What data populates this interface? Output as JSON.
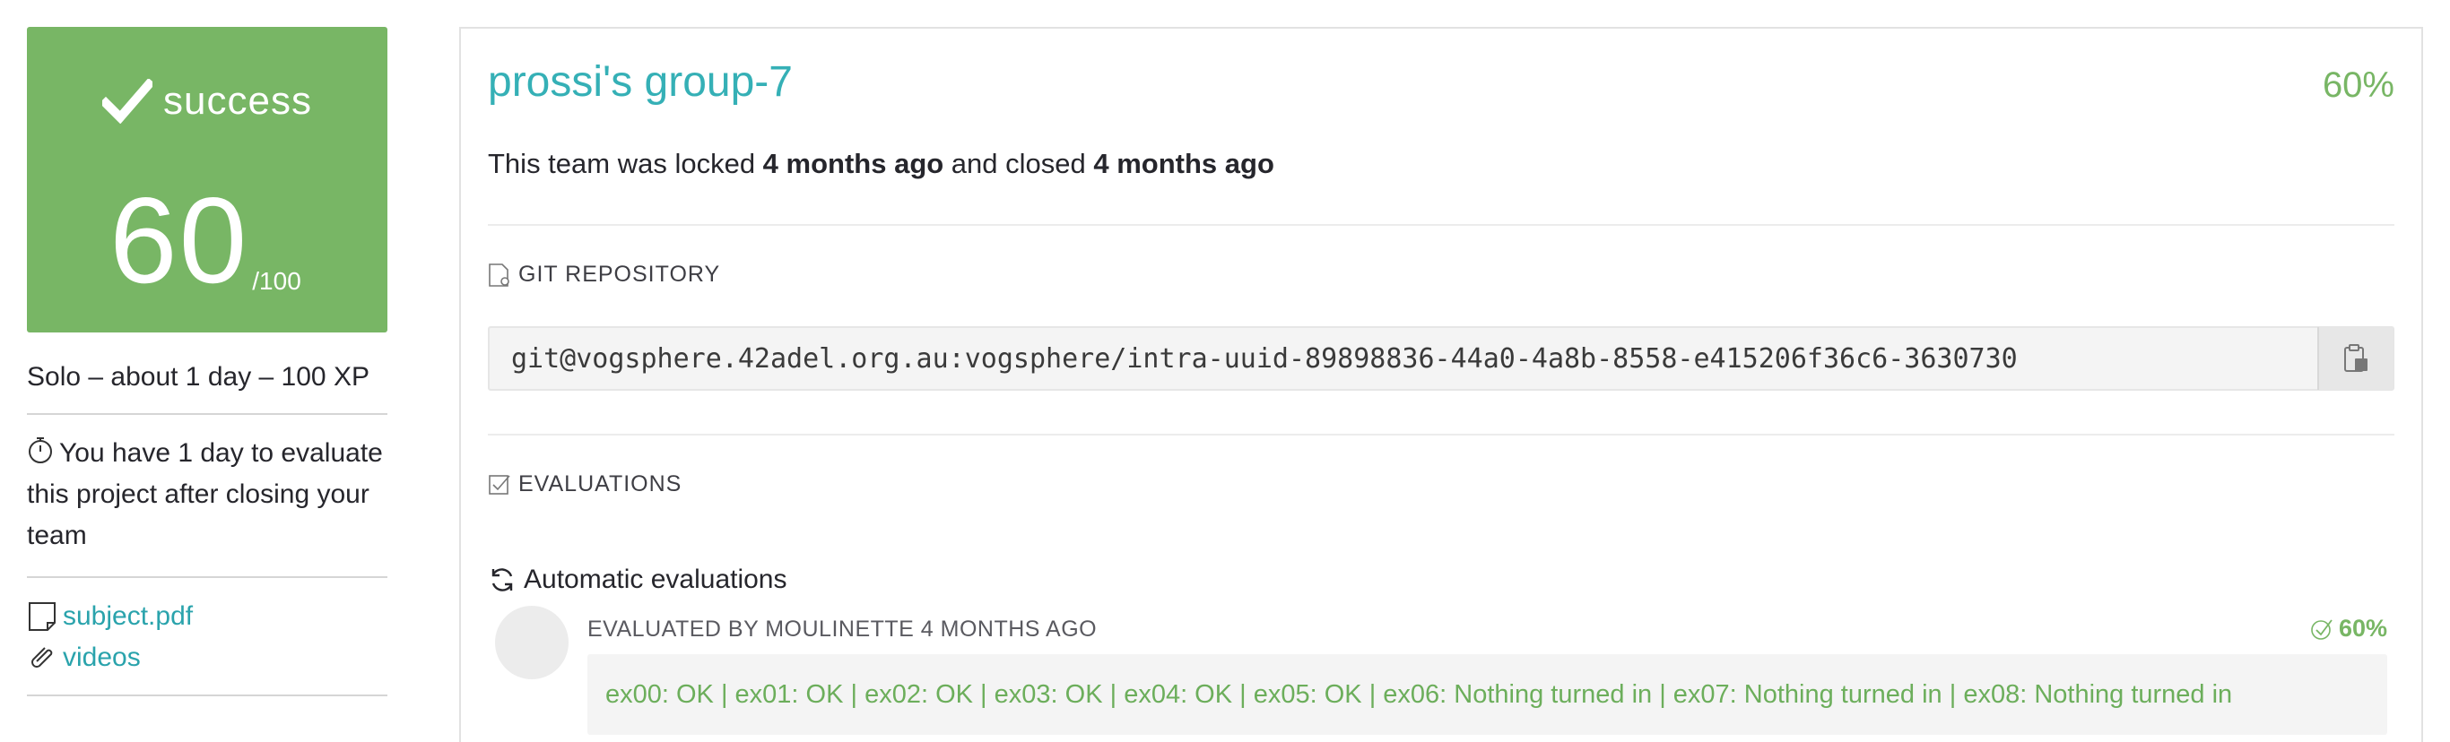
{
  "score_card": {
    "status": "success",
    "score": "60",
    "max": "/100"
  },
  "project_meta": "Solo – about 1 day – 100 XP",
  "evaluation_note": "You have 1 day to evaluate this project after closing your team",
  "links": {
    "subject": "subject.pdf",
    "videos": "videos"
  },
  "team": {
    "title": "prossi's group-7",
    "percent": "60%",
    "lock_prefix": "This team was locked ",
    "locked_ago": "4 months ago",
    "lock_middle": " and closed ",
    "closed_ago": "4 months ago"
  },
  "git": {
    "section_label": "GIT REPOSITORY",
    "url": "git@vogsphere.42adel.org.au:vogsphere/intra-uuid-89898836-44a0-4a8b-8558-e415206f36c6-3630730"
  },
  "evaluations": {
    "section_label": "EVALUATIONS",
    "automatic_label": "Automatic evaluations",
    "evaluated_by": "EVALUATED BY MOULINETTE 4 MONTHS AGO",
    "percent": "60%",
    "result": "ex00: OK | ex01: OK | ex02: OK | ex03: OK | ex04: OK | ex05: OK | ex06: Nothing turned in | ex07: Nothing turned in | ex08: Nothing turned in"
  },
  "colors": {
    "success_green": "#78b665",
    "link_teal": "#2aa3ac",
    "title_teal": "#35b0b6"
  },
  "icons": {
    "status": "checkmark-icon",
    "timer": "stopwatch-icon",
    "subject": "document-icon",
    "videos": "paperclip-icon",
    "git": "git-file-icon",
    "copy": "clipboard-icon",
    "evaluations": "checkbox-icon",
    "automatic": "refresh-icon",
    "eval_status": "check-circle-icon"
  }
}
